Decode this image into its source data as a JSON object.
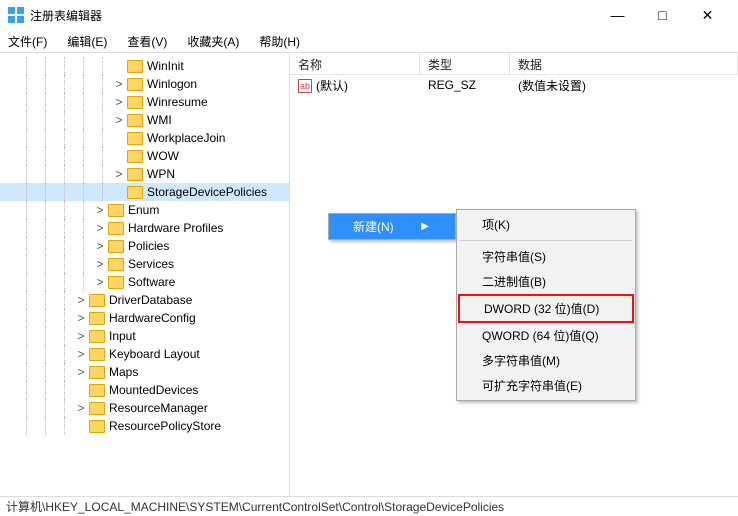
{
  "window": {
    "title": "注册表编辑器"
  },
  "menu": {
    "file": "文件(F)",
    "edit": "编辑(E)",
    "view": "查看(V)",
    "favorites": "收藏夹(A)",
    "help": "帮助(H)"
  },
  "tree": {
    "items": [
      {
        "label": "WinInit",
        "indent": 112,
        "expander": ""
      },
      {
        "label": "Winlogon",
        "indent": 112,
        "expander": ">"
      },
      {
        "label": "Winresume",
        "indent": 112,
        "expander": ">"
      },
      {
        "label": "WMI",
        "indent": 112,
        "expander": ">"
      },
      {
        "label": "WorkplaceJoin",
        "indent": 112,
        "expander": ""
      },
      {
        "label": "WOW",
        "indent": 112,
        "expander": ""
      },
      {
        "label": "WPN",
        "indent": 112,
        "expander": ">"
      },
      {
        "label": "StorageDevicePolicies",
        "indent": 112,
        "expander": "",
        "selected": true
      },
      {
        "label": "Enum",
        "indent": 93,
        "expander": ">"
      },
      {
        "label": "Hardware Profiles",
        "indent": 93,
        "expander": ">"
      },
      {
        "label": "Policies",
        "indent": 93,
        "expander": ">"
      },
      {
        "label": "Services",
        "indent": 93,
        "expander": ">"
      },
      {
        "label": "Software",
        "indent": 93,
        "expander": ">"
      },
      {
        "label": "DriverDatabase",
        "indent": 74,
        "expander": ">"
      },
      {
        "label": "HardwareConfig",
        "indent": 74,
        "expander": ">"
      },
      {
        "label": "Input",
        "indent": 74,
        "expander": ">"
      },
      {
        "label": "Keyboard Layout",
        "indent": 74,
        "expander": ">"
      },
      {
        "label": "Maps",
        "indent": 74,
        "expander": ">"
      },
      {
        "label": "MountedDevices",
        "indent": 74,
        "expander": ""
      },
      {
        "label": "ResourceManager",
        "indent": 74,
        "expander": ">"
      },
      {
        "label": "ResourcePolicyStore",
        "indent": 74,
        "expander": ""
      }
    ]
  },
  "list": {
    "header": {
      "name": "名称",
      "type": "类型",
      "data": "数据"
    },
    "rows": [
      {
        "icon": "ab",
        "name": "(默认)",
        "type": "REG_SZ",
        "data": "(数值未设置)"
      }
    ]
  },
  "context": {
    "new": "新建(N)",
    "submenu": {
      "key": "项(K)",
      "string": "字符串值(S)",
      "binary": "二进制值(B)",
      "dword": "DWORD (32 位)值(D)",
      "qword": "QWORD (64 位)值(Q)",
      "multi": "多字符串值(M)",
      "expand": "可扩充字符串值(E)"
    }
  },
  "status": {
    "path": "计算机\\HKEY_LOCAL_MACHINE\\SYSTEM\\CurrentControlSet\\Control\\StorageDevicePolicies"
  }
}
